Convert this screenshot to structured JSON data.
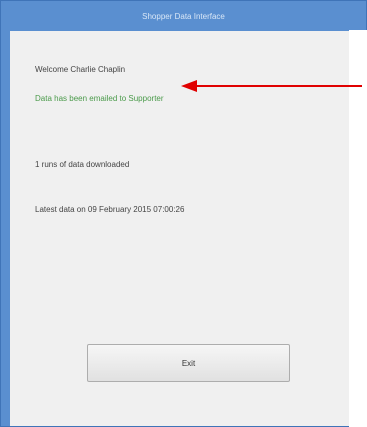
{
  "window": {
    "title": "Shopper Data Interface"
  },
  "content": {
    "welcome_text": "Welcome Charlie Chaplin",
    "emailed_text": "Data has been emailed to Supporter",
    "runs_text": "1 runs of data downloaded",
    "latest_text": "Latest data on 09 February 2015 07:00:26"
  },
  "actions": {
    "exit_label": "Exit"
  },
  "colors": {
    "title_bar": "#5a8fd0",
    "status_green": "#4a9a4a",
    "annotation_arrow": "#e00000"
  },
  "icons": {
    "annotation": "red-arrow-icon"
  }
}
